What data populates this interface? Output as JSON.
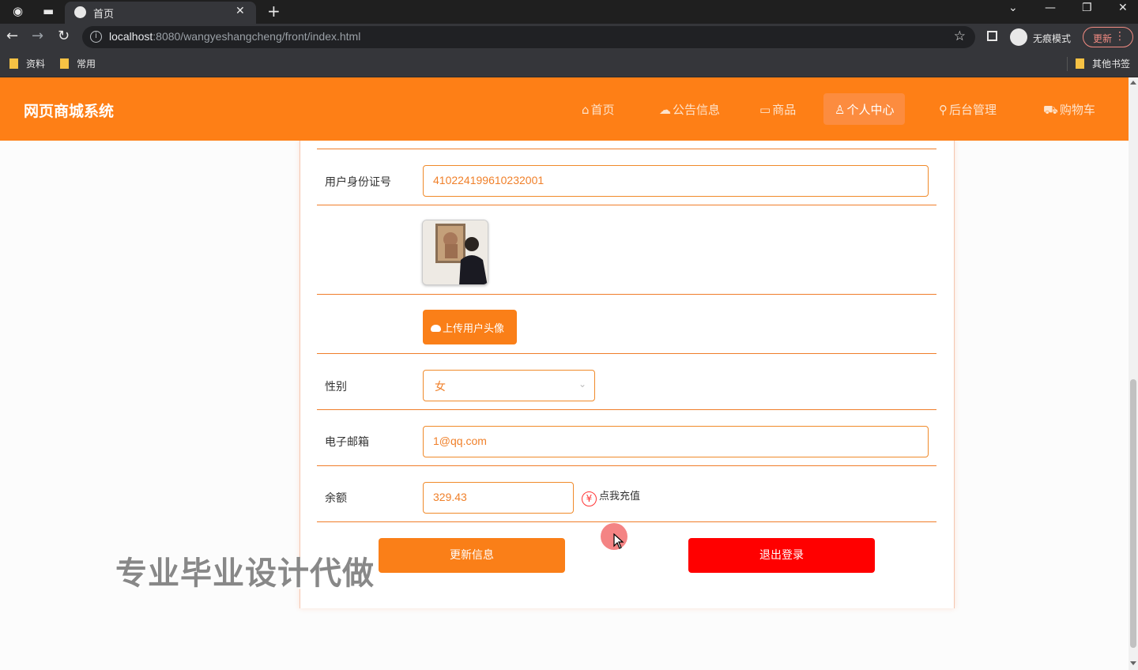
{
  "browser": {
    "tab_title": "首页",
    "url_host": "localhost",
    "url_rest": ":8080/wangyeshangcheng/front/index.html",
    "incognito_label": "无痕模式",
    "update_label": "更新",
    "bookmarks": [
      "资料",
      "常用"
    ],
    "other_bookmarks": "其他书签"
  },
  "site": {
    "title": "网页商城系统",
    "nav": [
      {
        "label": "首页",
        "icon": "home-icon"
      },
      {
        "label": "公告信息",
        "icon": "cloud-icon"
      },
      {
        "label": "商品",
        "icon": "book-icon"
      },
      {
        "label": "个人中心",
        "icon": "user-icon",
        "active": true
      },
      {
        "label": "后台管理",
        "icon": "link-icon"
      },
      {
        "label": "购物车",
        "icon": "cart-icon"
      }
    ]
  },
  "form": {
    "id_label": "用户身份证号",
    "id_value": "410224199610232001",
    "upload_label": "上传用户头像",
    "gender_label": "性别",
    "gender_value": "女",
    "email_label": "电子邮箱",
    "email_value": "1@qq.com",
    "balance_label": "余额",
    "balance_value": "329.43",
    "recharge_icon": "¥",
    "recharge_label": "点我充值",
    "update_button": "更新信息",
    "logout_button": "退出登录"
  },
  "watermark": "专业毕业设计代做",
  "colors": {
    "brand": "#fe7f16",
    "logout": "#ff0000",
    "field_border": "#f08a2a"
  }
}
